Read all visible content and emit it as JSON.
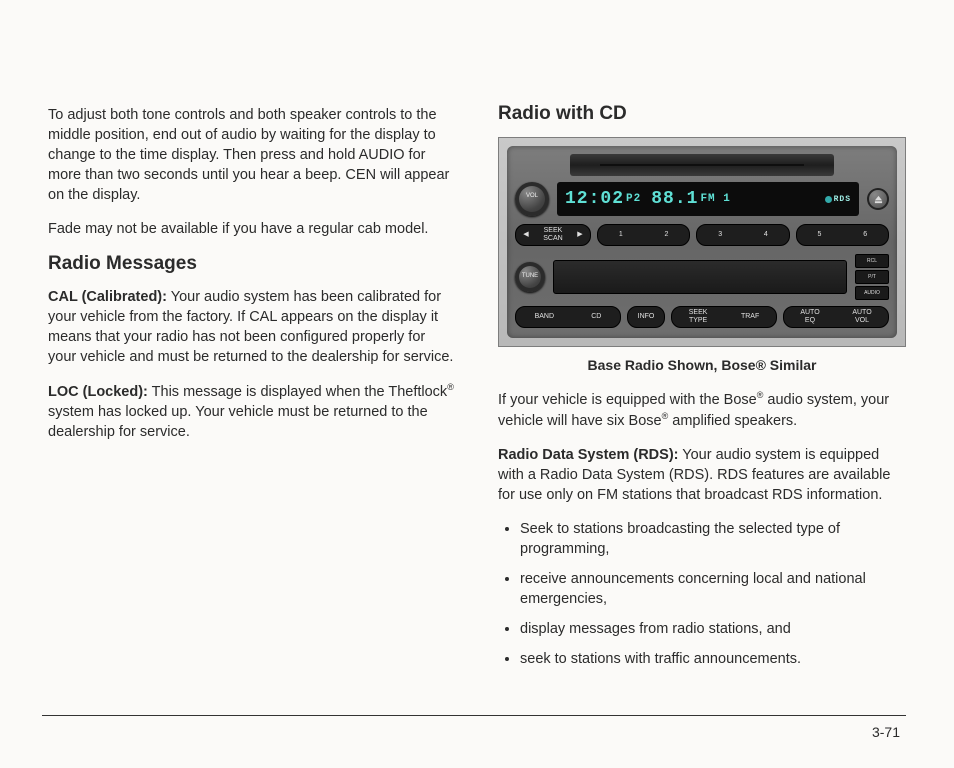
{
  "leftColumn": {
    "para1": "To adjust both tone controls and both speaker controls to the middle position, end out of audio by waiting for the display to change to the time display. Then press and hold AUDIO for more than two seconds until you hear a beep. CEN will appear on the display.",
    "para2": "Fade may not be available if you have a regular cab model.",
    "heading": "Radio Messages",
    "calLabel": "CAL (Calibrated):",
    "calText": " Your audio system has been calibrated for your vehicle from the factory. If CAL appears on the display it means that your radio has not been configured properly for your vehicle and must be returned to the dealership for service.",
    "locLabel": "LOC (Locked):",
    "locText1": " This message is displayed when the Theftlock",
    "locText2": " system has locked up. Your vehicle must be returned to the dealership for service."
  },
  "rightColumn": {
    "heading": "Radio with CD",
    "caption": "Base Radio Shown, Bose® Similar",
    "para1a": "If your vehicle is equipped with the Bose",
    "para1b": " audio system, your vehicle will have six Bose",
    "para1c": " amplified speakers.",
    "rdsLabel": "Radio Data System (RDS):",
    "rdsText": " Your audio system is equipped with a Radio Data System (RDS). RDS features are available for use only on FM stations that broadcast RDS information.",
    "bullets": [
      "Seek to stations broadcasting the selected type of programming,",
      "receive announcements concerning local and national emergencies,",
      "display messages from radio stations, and",
      "seek to stations with traffic announcements."
    ]
  },
  "radio": {
    "time": "12:02",
    "preset": "P2",
    "freq": "88.1",
    "band": "FM 1",
    "rdsLabel": "RDS",
    "knobTop": "VOL",
    "knobBottom": "TUNE",
    "seekLeft": "◀",
    "seekLabel": "SEEK\nSCAN",
    "seekRight": "▶",
    "presets": [
      "1",
      "2",
      "3",
      "4",
      "5",
      "6"
    ],
    "squareButtons": [
      "RCL",
      "P/T",
      "AUDIO"
    ],
    "bottomButtons": [
      "BAND",
      "CD",
      "INFO",
      "SEEK\nTYPE",
      "TRAF",
      "AUTO\nEQ",
      "AUTO\nVOL"
    ]
  },
  "pageNumber": "3-71",
  "reg": "®"
}
